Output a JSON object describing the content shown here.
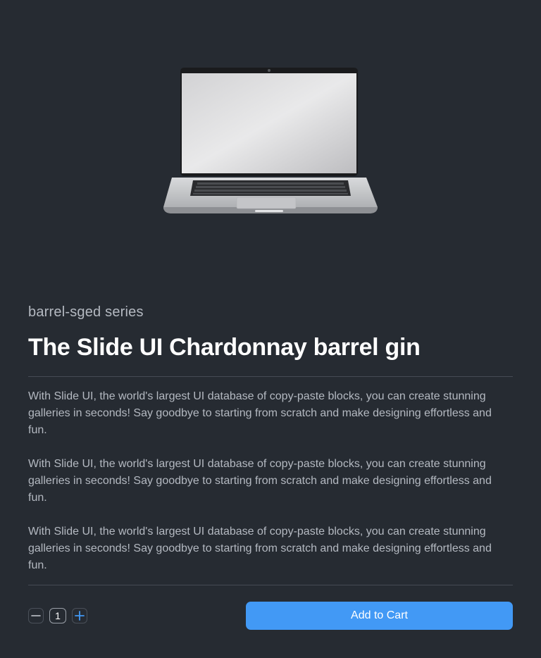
{
  "product": {
    "series": "barrel-sged series",
    "title": "The Slide UI Chardonnay barrel gin",
    "description": [
      "With Slide UI, the world's largest UI database of copy-paste blocks, you can create stunning galleries in seconds! Say goodbye to starting from scratch and make designing effortless and fun.",
      "With Slide UI, the world's largest UI database of copy-paste blocks, you can create stunning galleries in seconds! Say goodbye to starting from scratch and make designing effortless and fun.",
      "With Slide UI, the world's largest UI database of copy-paste blocks, you can create stunning galleries in seconds! Say goodbye to starting from scratch and make designing effortless and fun."
    ],
    "image_icon": "laptop-image"
  },
  "quantity": {
    "value": "1",
    "decrement_icon": "minus-icon",
    "increment_icon": "plus-icon"
  },
  "cart": {
    "label": "Add to Cart",
    "color": "#4299f5"
  },
  "theme": {
    "background": "#262b32",
    "text_primary": "#ffffff",
    "text_secondary": "#b4b9c1"
  }
}
